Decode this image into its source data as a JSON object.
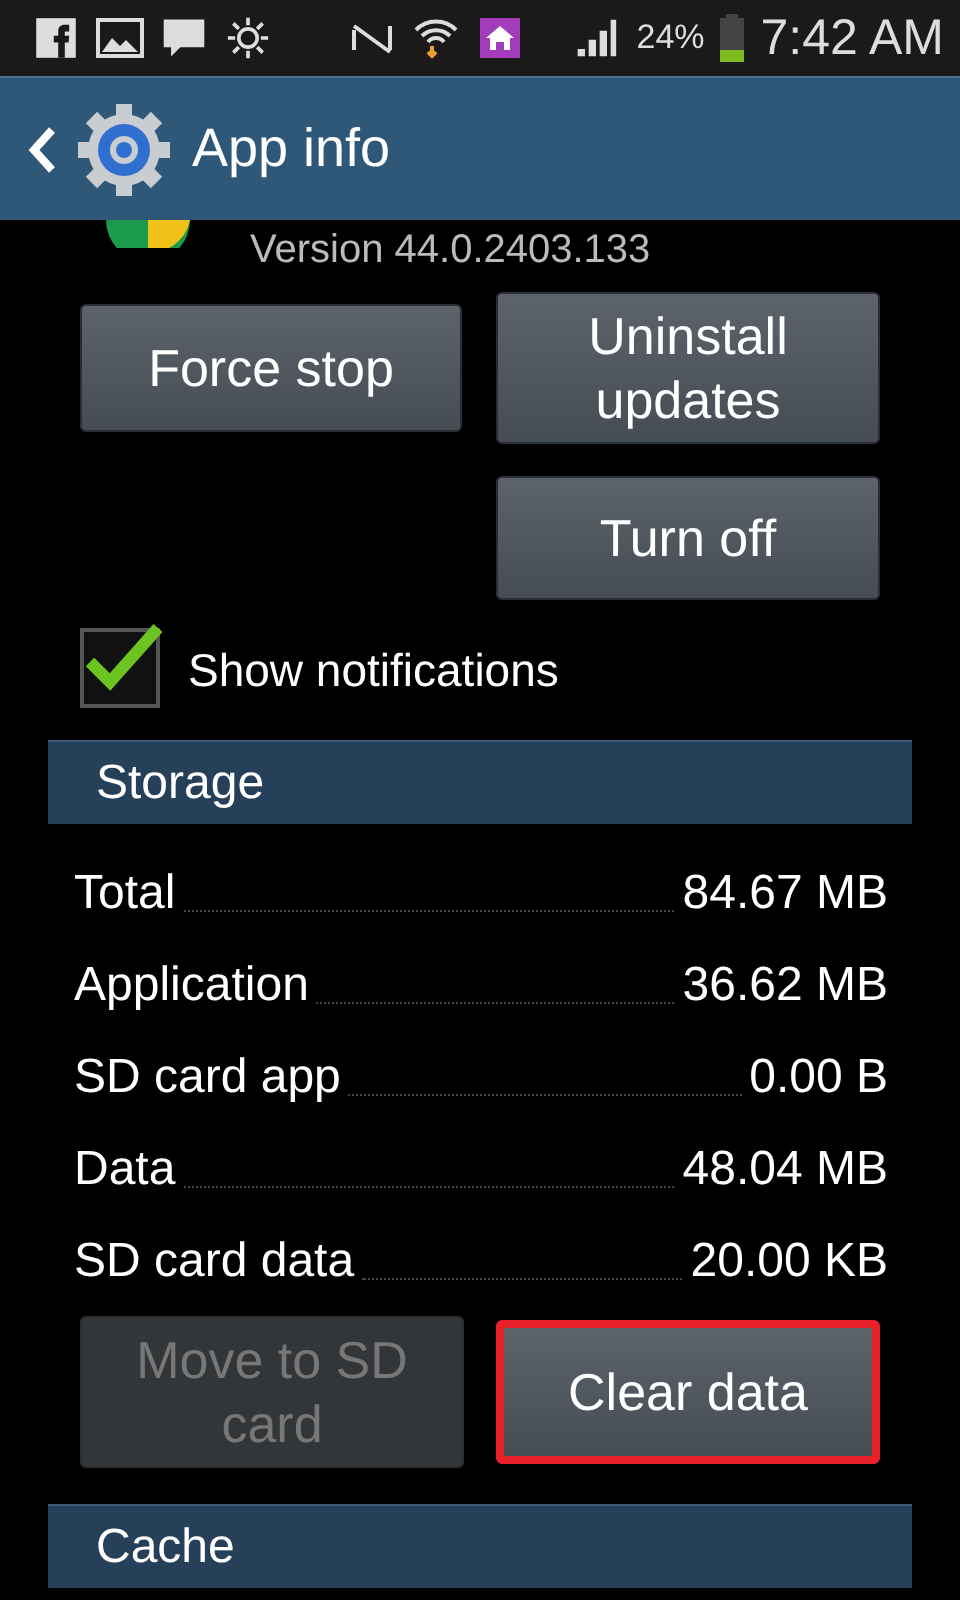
{
  "status_bar": {
    "battery": "24%",
    "time": "7:42 AM"
  },
  "header": {
    "title": "App info"
  },
  "app": {
    "version": "Version 44.0.2403.133"
  },
  "buttons": [
    {
      "label": "Force stop",
      "disabled": false,
      "highlighted": false
    },
    {
      "label": "Uninstall updates",
      "disabled": false,
      "highlighted": false
    },
    {
      "label": "Turn off",
      "disabled": false,
      "highlighted": false
    }
  ],
  "notifications": {
    "label": "Show notifications",
    "checked": true
  },
  "storage": {
    "title": "Storage",
    "rows": [
      {
        "label": "Total",
        "value": "84.67 MB"
      },
      {
        "label": "Application",
        "value": "36.62 MB"
      },
      {
        "label": "SD card app",
        "value": "0.00 B"
      },
      {
        "label": "Data",
        "value": "48.04 MB"
      },
      {
        "label": "SD card data",
        "value": "20.00 KB"
      }
    ],
    "buttons": [
      {
        "label": "Move to SD card",
        "disabled": true,
        "highlighted": false
      },
      {
        "label": "Clear data",
        "disabled": false,
        "highlighted": true
      }
    ]
  },
  "cache": {
    "title": "Cache"
  }
}
